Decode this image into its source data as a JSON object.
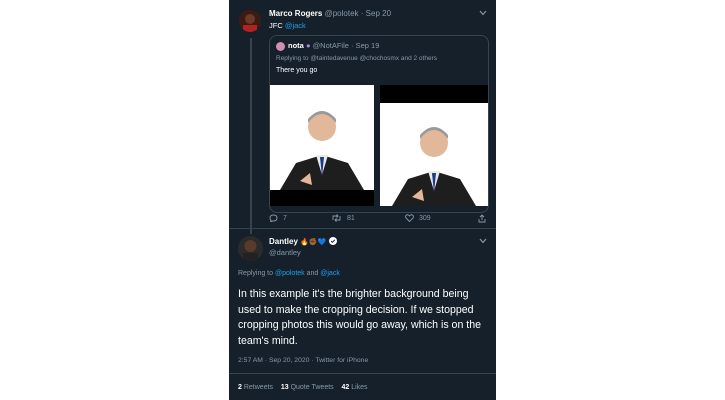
{
  "tweet1": {
    "name": "Marco Rogers",
    "handle": "@polotek",
    "dot": "·",
    "date": "Sep 20",
    "text_prefix": "JFC",
    "mention": "@jack"
  },
  "quoted": {
    "name": "nota",
    "handle": "@NotAFile",
    "dot": "·",
    "date": "Sep 19",
    "replying": "Replying to @taintedavenue @chochosmx and 2 others",
    "text": "There you go"
  },
  "actions": {
    "replies": "7",
    "retweets": "81",
    "likes": "309"
  },
  "tweet2": {
    "name": "Dantley",
    "emoji": "🔥✊🏾💙",
    "handle": "@dantley",
    "replying_prefix": "Replying to",
    "replying_user1": "@polotek",
    "replying_and": "and",
    "replying_user2": "@jack",
    "body": "In this example it's the brighter background being used to make the cropping decision. If we stopped cropping photos this would go away, which is on the team's mind.",
    "meta": "2:57 AM · Sep 20, 2020 · Twitter for iPhone"
  },
  "stats": {
    "retweets_count": "2",
    "retweets_label": "Retweets",
    "quotes_count": "13",
    "quotes_label": "Quote Tweets",
    "likes_count": "42",
    "likes_label": "Likes"
  },
  "colors": {
    "background": "#15202b",
    "accent": "#1da1f2",
    "secondary": "#8899a6",
    "border": "#38444d"
  },
  "icons": [
    "chevron-down-icon",
    "reply-icon",
    "retweet-icon",
    "like-icon",
    "share-icon",
    "verified-icon"
  ]
}
